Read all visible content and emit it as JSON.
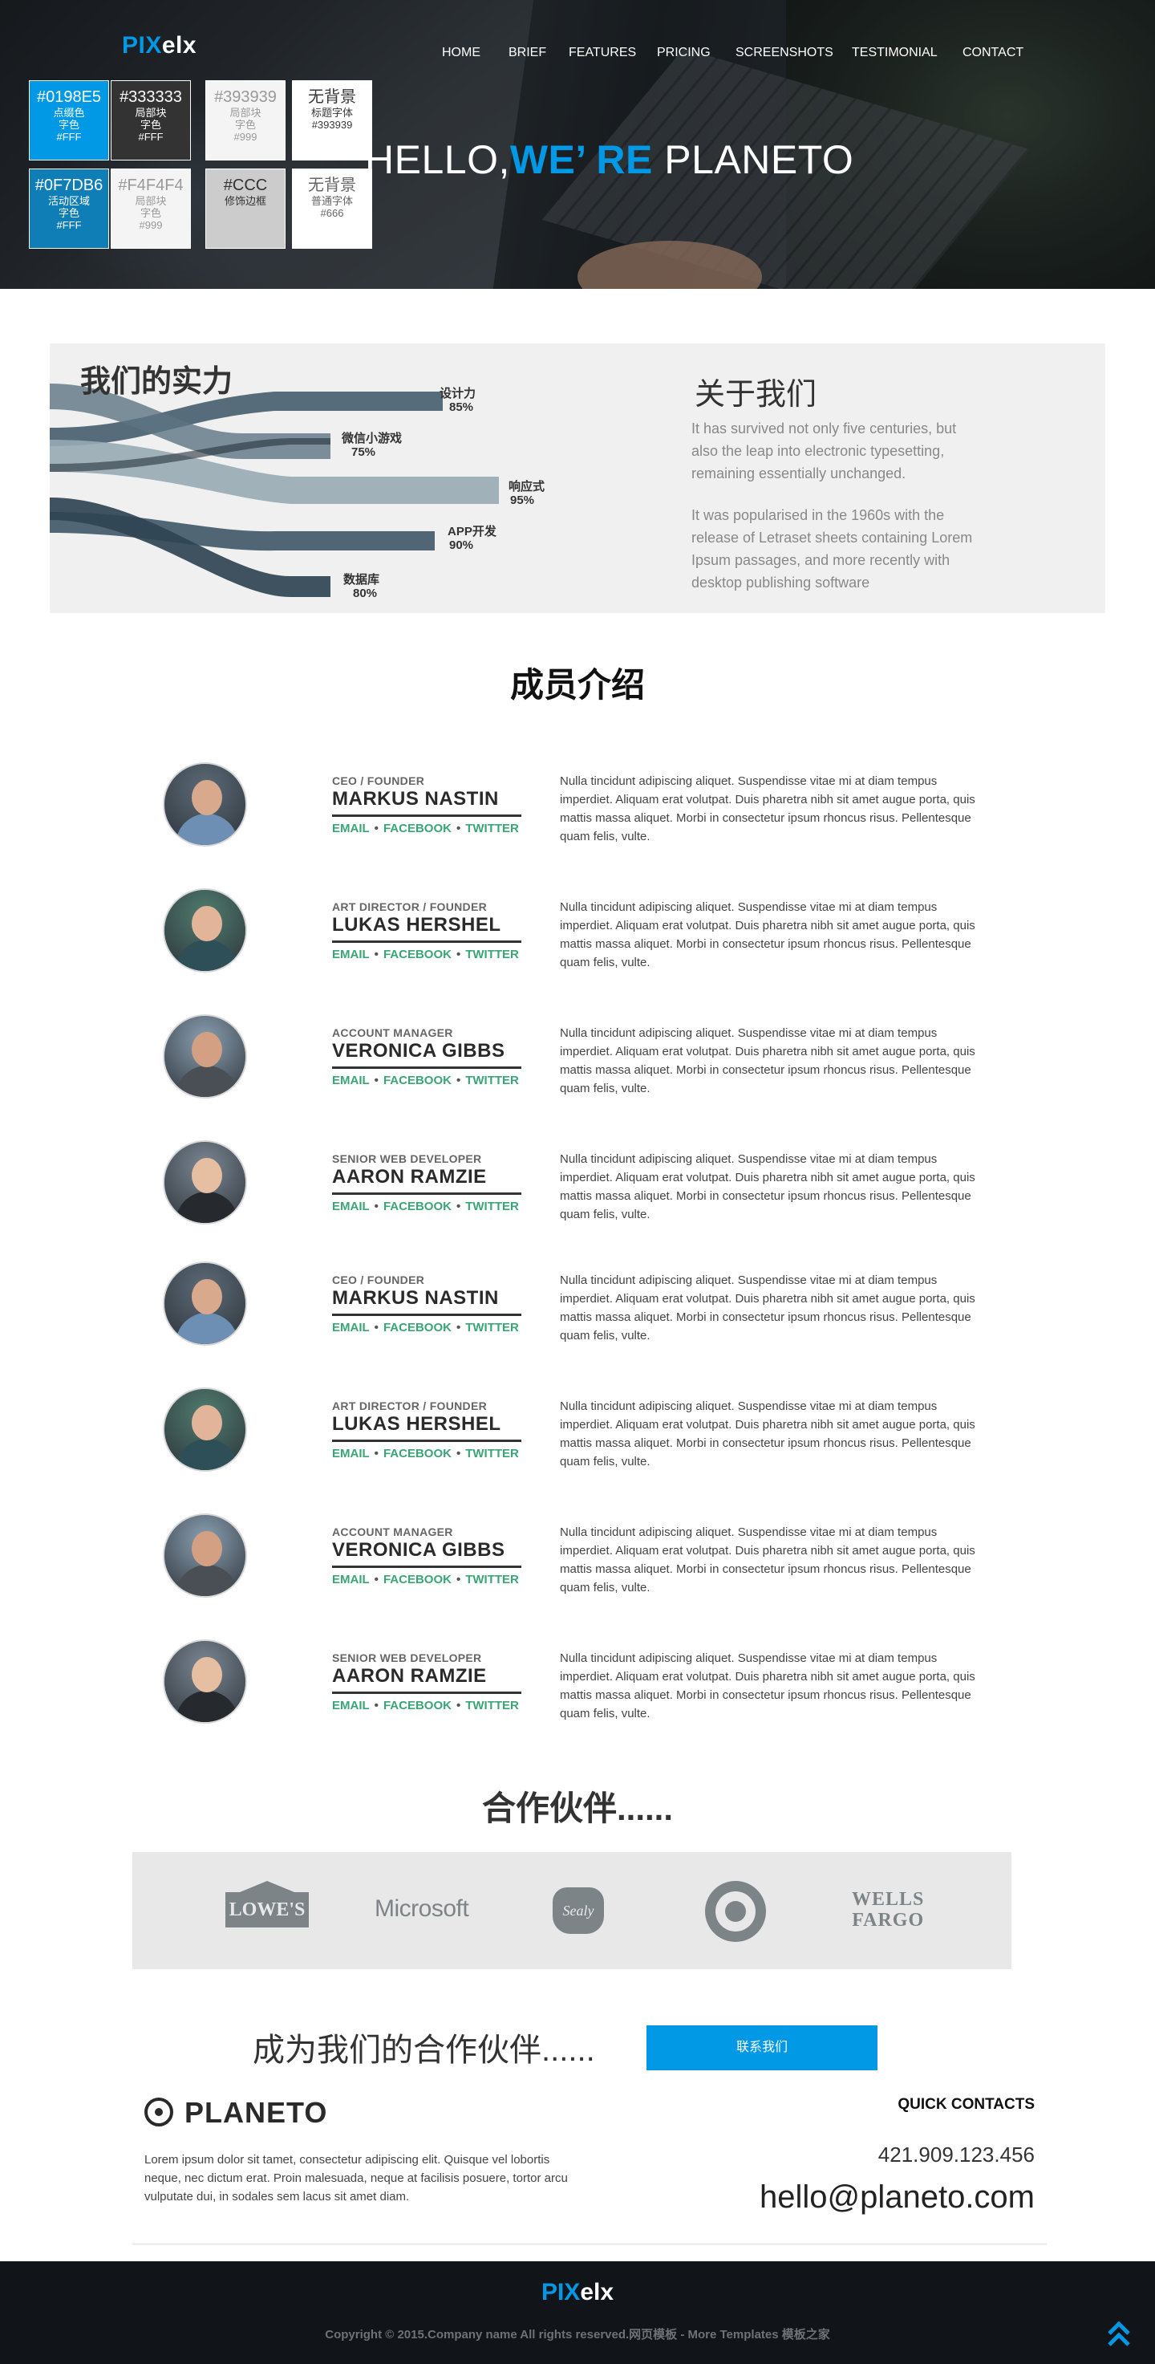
{
  "brand": {
    "pix": "PIX",
    "elx": "elx"
  },
  "nav": [
    "HOME",
    "BRIEF",
    "FEATURES",
    "PRICING",
    "SCREENSHOTS",
    "TESTIMONIAL",
    "CONTACT"
  ],
  "hero": {
    "title_pre": "HELLO,",
    "title_accent": "WE’  RE",
    "title_post": " PLANETO"
  },
  "swatches": [
    {
      "hex": "#0198E5",
      "lines": [
        "点缀色",
        "字色",
        "#FFF"
      ],
      "bg": "#0198E5",
      "fg": "#ffffff"
    },
    {
      "hex": "#333333",
      "lines": [
        "局部块",
        "字色",
        "#FFF"
      ],
      "bg": "#333333",
      "fg": "#ffffff"
    },
    {
      "hex": "#393939",
      "lines": [
        "局部块",
        "字色",
        "#999"
      ],
      "bg": "#f4f4f4",
      "fg": "#999999"
    },
    {
      "hex": "无背景",
      "lines": [
        "标题字体",
        "#393939"
      ],
      "bg": "#ffffff",
      "fg": "#393939"
    },
    {
      "hex": "#0F7DB6",
      "lines": [
        "活动区域",
        "字色",
        "#FFF"
      ],
      "bg": "#0F7DB6",
      "fg": "#ffffff"
    },
    {
      "hex": "#F4F4F4",
      "lines": [
        "局部块",
        "字色",
        "#999"
      ],
      "bg": "#F4F4F4",
      "fg": "#999999"
    },
    {
      "hex": "#CCC",
      "lines": [
        "修饰边框"
      ],
      "bg": "#cccccc",
      "fg": "#333333"
    },
    {
      "hex": "无背景",
      "lines": [
        "普通字体",
        "#666"
      ],
      "bg": "#ffffff",
      "fg": "#666666"
    }
  ],
  "strength": {
    "title": "我们的实力",
    "skills": [
      {
        "name": "设计力",
        "pct": "85%"
      },
      {
        "name": "微信小游戏",
        "pct": "75%"
      },
      {
        "name": "响应式",
        "pct": "95%"
      },
      {
        "name": "APP开发",
        "pct": "90%"
      },
      {
        "name": "数据库",
        "pct": "80%"
      }
    ]
  },
  "about": {
    "title": "关于我们",
    "p1": "It has survived not only five centuries, but also the leap into electronic typesetting, remaining essentially unchanged.",
    "p2": "It was popularised in the 1960s with the release of Letraset sheets containing Lorem Ipsum passages, and more recently with desktop publishing software"
  },
  "team": {
    "title": "成员介绍",
    "links": [
      "EMAIL",
      "FACEBOOK",
      "TWITTER"
    ],
    "members": [
      {
        "role": "CEO / FOUNDER",
        "name": "MARKUS NASTIN",
        "desc": "Nulla tincidunt adipiscing aliquet. Suspendisse vitae mi at diam tempus imperdiet. Aliquam erat volutpat. Duis pharetra nibh sit amet augue porta, quis mattis massa aliquet. Morbi in consectetur ipsum rhoncus risus. Pellentesque quam felis, vulte."
      },
      {
        "role": "ART DIRECTOR / FOUNDER",
        "name": "LUKAS HERSHEL",
        "desc": "Nulla tincidunt adipiscing aliquet. Suspendisse vitae mi at diam tempus imperdiet. Aliquam erat volutpat. Duis pharetra nibh sit amet augue porta, quis mattis massa aliquet. Morbi in consectetur ipsum rhoncus risus. Pellentesque quam felis, vulte."
      },
      {
        "role": "ACCOUNT MANAGER",
        "name": "VERONICA GIBBS",
        "desc": "Nulla tincidunt adipiscing aliquet. Suspendisse vitae mi at diam tempus imperdiet. Aliquam erat volutpat. Duis pharetra nibh sit amet augue porta, quis mattis massa aliquet. Morbi in consectetur ipsum rhoncus risus. Pellentesque quam felis, vulte."
      },
      {
        "role": "SENIOR WEB DEVELOPER",
        "name": "AARON RAMZIE",
        "desc": "Nulla tincidunt adipiscing aliquet. Suspendisse vitae mi at diam tempus imperdiet. Aliquam erat volutpat. Duis pharetra nibh sit amet augue porta, quis mattis massa aliquet. Morbi in consectetur ipsum rhoncus risus. Pellentesque quam felis, vulte."
      },
      {
        "role": "CEO / FOUNDER",
        "name": "MARKUS NASTIN",
        "desc": "Nulla tincidunt adipiscing aliquet. Suspendisse vitae mi at diam tempus imperdiet. Aliquam erat volutpat. Duis pharetra nibh sit amet augue porta, quis mattis massa aliquet. Morbi in consectetur ipsum rhoncus risus. Pellentesque quam felis, vulte."
      },
      {
        "role": "ART DIRECTOR / FOUNDER",
        "name": "LUKAS HERSHEL",
        "desc": "Nulla tincidunt adipiscing aliquet. Suspendisse vitae mi at diam tempus imperdiet. Aliquam erat volutpat. Duis pharetra nibh sit amet augue porta, quis mattis massa aliquet. Morbi in consectetur ipsum rhoncus risus. Pellentesque quam felis, vulte."
      },
      {
        "role": "ACCOUNT MANAGER",
        "name": "VERONICA GIBBS",
        "desc": "Nulla tincidunt adipiscing aliquet. Suspendisse vitae mi at diam tempus imperdiet. Aliquam erat volutpat. Duis pharetra nibh sit amet augue porta, quis mattis massa aliquet. Morbi in consectetur ipsum rhoncus risus. Pellentesque quam felis, vulte."
      },
      {
        "role": "SENIOR WEB DEVELOPER",
        "name": "AARON RAMZIE",
        "desc": "Nulla tincidunt adipiscing aliquet. Suspendisse vitae mi at diam tempus imperdiet. Aliquam erat volutpat. Duis pharetra nibh sit amet augue porta, quis mattis massa aliquet. Morbi in consectetur ipsum rhoncus risus. Pellentesque quam felis, vulte."
      }
    ]
  },
  "partners": {
    "title": "合作伙伴......",
    "logos": [
      "Lowe's",
      "Microsoft",
      "Sealy",
      "Target",
      "WELLS FARGO"
    ],
    "lowes_text": "LOWE'S",
    "microsoft_text": "Microsoft",
    "sealy_text": "Sealy",
    "wells_line1": "WELLS",
    "wells_line2": "FARGO"
  },
  "cta": {
    "text": "成为我们的合作伙伴......",
    "button": "联系我们"
  },
  "footer": {
    "logo": "PLANETO",
    "about": "Lorem ipsum dolor sit tamet, consectetur adipiscing elit. Quisque vel lobortis neque, nec dictum erat. Proin malesuada, neque at facilisis posuere, tortor arcu vulputate dui, in sodales sem lacus sit amet diam.",
    "quick_contacts": "QUICK CONTACTS",
    "phone": "421.909.123.456",
    "email": "hello@planeto.com",
    "copyright": "Copyright © 2015.Company name All rights reserved.网页模板 - More Templates 模板之家"
  },
  "colors": {
    "accent": "#0198E5",
    "link_green": "#3aa676",
    "dark": "#333333",
    "light_block": "#F4F4F4"
  },
  "icons": {
    "scroll_top": "double-chevron-up-icon",
    "footer_logo": "target-circle-icon"
  }
}
